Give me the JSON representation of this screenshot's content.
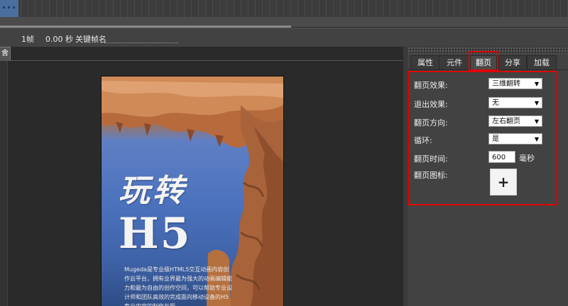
{
  "infobar": {
    "frame_count": "1帧",
    "time": "0.00 秒",
    "keyframe_label": "关键帧名"
  },
  "stage": {
    "tab_label": "舍"
  },
  "page": {
    "title_line1": "玩转",
    "title_line2": "H5",
    "description": "Mugeda是专业级HTML5交互动画内容创作云平台，拥有业界最为强大的动画编辑能力和最为自由的创作空间，可以帮助专业设计师和团队高效的完成面向移动设备的H5专业内容的制作与服..."
  },
  "panel": {
    "tabs": [
      {
        "label": "属性"
      },
      {
        "label": "元件"
      },
      {
        "label": "翻页"
      },
      {
        "label": "分享"
      },
      {
        "label": "加载"
      }
    ],
    "active_tab": "翻页",
    "fields": {
      "flip_effect": {
        "label": "翻页效果:",
        "value": "三维翻转"
      },
      "exit_effect": {
        "label": "退出效果:",
        "value": "无"
      },
      "flip_direction": {
        "label": "翻页方向:",
        "value": "左右翻页"
      },
      "loop": {
        "label": "循环:",
        "value": "是"
      },
      "flip_time": {
        "label": "翻页时间:",
        "value": "600",
        "unit": "毫秒"
      },
      "flip_icon": {
        "label": "翻页图标:",
        "button": "+"
      }
    }
  },
  "icons": {
    "dropdown": "chevron-down-icon",
    "add": "plus-icon"
  },
  "colors": {
    "highlight": "#e00000",
    "panel_bg": "#424242",
    "stage_bg": "#2a2a2a"
  }
}
